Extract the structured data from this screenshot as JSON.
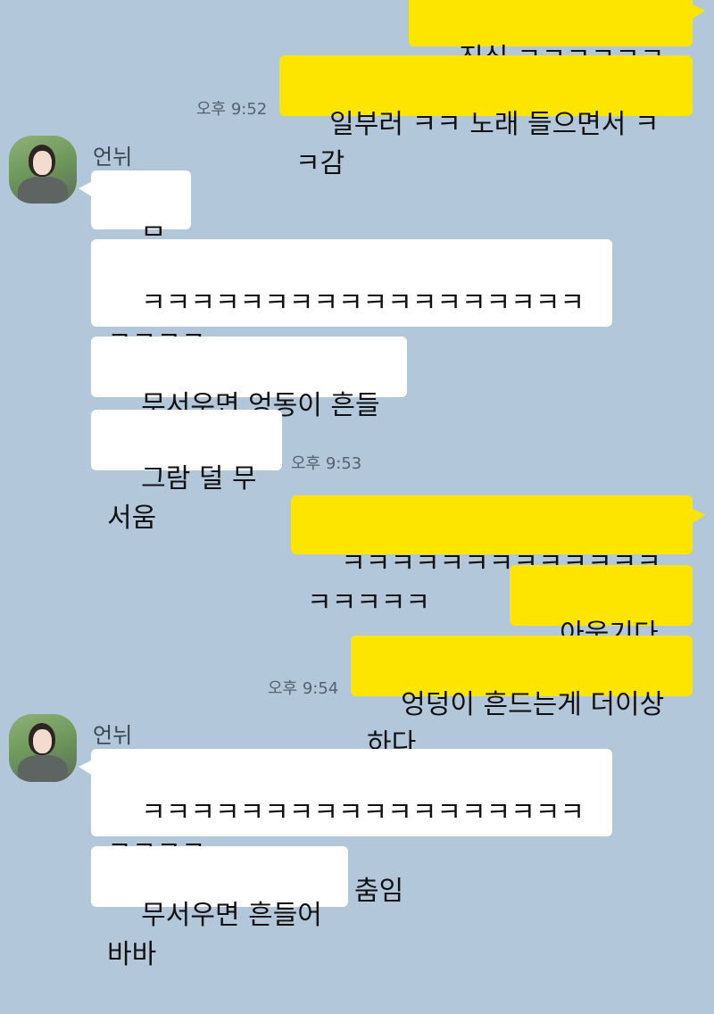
{
  "contact": {
    "name": "언뉘"
  },
  "messages": {
    "m1": "진심 ㅋㅋㅋㅋㅋㅋㅋㅋ",
    "m2": "일부러 ㅋㅋ 노래 들으면서 ㅋㅋ감",
    "t1": "오후 9:52",
    "m3": "무섭다",
    "m4": "ㅋㅋㅋㅋㅋㅋㅋㅋㅋㅋㅋㅋㅋㅋㅋㅋㅋㅋㅋㅋㅋㅋ\nㅋ",
    "m5": "무서우면 엉동이 흔들어라",
    "m6": "그람 덜 무서움",
    "t2": "오후 9:53",
    "m7": "ㅋㅋㅋㅋㅋㅋㅋㅋㅋㅋㅋㅋㅋㅋㅋㅋㅋㅋ",
    "m8": "아웃기다 ㅋㅋ",
    "m9": "엉덩이 흔드는게 더이상하다",
    "t3": "오후 9:54",
    "m10": "ㅋㅋㅋㅋㅋㅋㅋㅋㅋㅋㅋㅋㅋㅋㅋㅋㅋㅋㅋㅋㅋㅋ\nㅋ 무서움을 물리치는 춤임",
    "m11": "무서우면 흔들어바바"
  },
  "colors": {
    "background": "#b2c7da",
    "my_bubble": "#fee500",
    "other_bubble": "#ffffff"
  }
}
